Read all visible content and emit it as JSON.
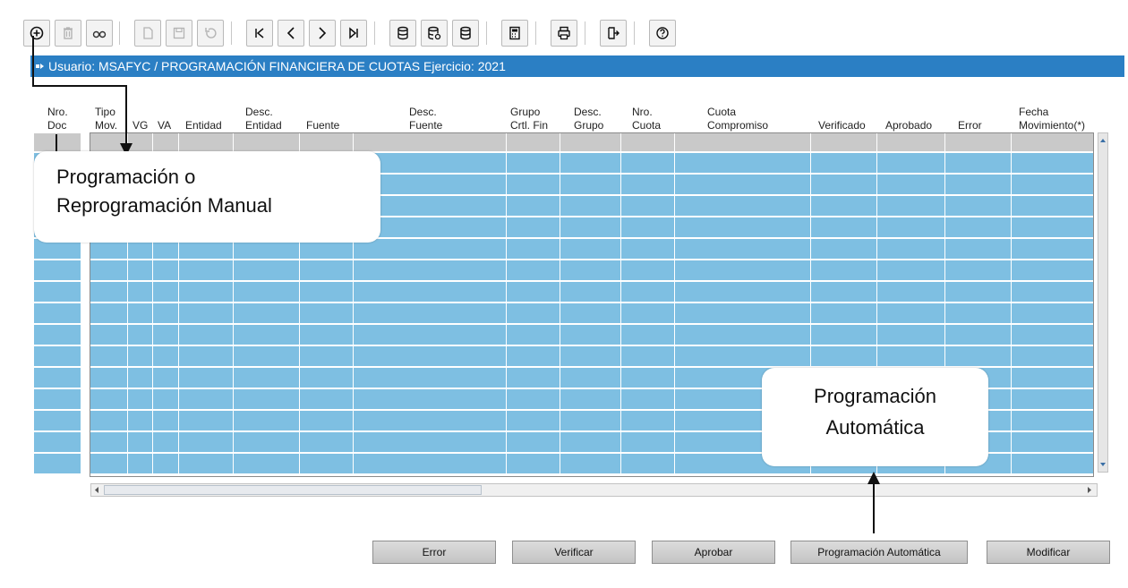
{
  "toolbar": {
    "buttons": [
      {
        "icon": "add-record-icon"
      },
      {
        "icon": "delete-record-icon"
      },
      {
        "icon": "search-binoculars-icon"
      },
      {
        "icon": "new-document-icon"
      },
      {
        "icon": "save-icon"
      },
      {
        "icon": "undo-icon"
      },
      {
        "icon": "first-record-icon"
      },
      {
        "icon": "previous-record-icon"
      },
      {
        "icon": "next-record-icon"
      },
      {
        "icon": "last-record-icon"
      },
      {
        "icon": "database-query-icon"
      },
      {
        "icon": "database-execute-icon"
      },
      {
        "icon": "database-count-icon"
      },
      {
        "icon": "calculator-icon"
      },
      {
        "icon": "print-icon"
      },
      {
        "icon": "exit-icon"
      },
      {
        "icon": "help-icon"
      }
    ]
  },
  "window": {
    "title": "Usuario: MSAFYC  /  PROGRAMACIÓN FINANCIERA DE CUOTAS  Ejercicio: 2021"
  },
  "grid": {
    "columns": [
      {
        "key": "nro_doc",
        "line1": "Nro.",
        "line2": "Doc"
      },
      {
        "key": "tipo_mov",
        "line1": "Tipo",
        "line2": "Mov."
      },
      {
        "key": "vg",
        "line1": "",
        "line2": "VG"
      },
      {
        "key": "va",
        "line1": "",
        "line2": "VA"
      },
      {
        "key": "entidad",
        "line1": "",
        "line2": "Entidad"
      },
      {
        "key": "desc_entidad",
        "line1": "Desc.",
        "line2": "Entidad"
      },
      {
        "key": "fuente",
        "line1": "",
        "line2": "Fuente"
      },
      {
        "key": "desc_fuente",
        "line1": "Desc.",
        "line2": "Fuente"
      },
      {
        "key": "grupo_crtl",
        "line1": "Grupo",
        "line2": "Crtl. Fin"
      },
      {
        "key": "desc_grupo",
        "line1": "Desc.",
        "line2": "Grupo"
      },
      {
        "key": "nro_cuota",
        "line1": "Nro.",
        "line2": "Cuota"
      },
      {
        "key": "cuota_compromiso",
        "line1": "Cuota",
        "line2": "Compromiso"
      },
      {
        "key": "verificado",
        "line1": "",
        "line2": "Verificado"
      },
      {
        "key": "aprobado",
        "line1": "",
        "line2": "Aprobado"
      },
      {
        "key": "error",
        "line1": "",
        "line2": "Error"
      },
      {
        "key": "fecha_mov",
        "line1": "Fecha",
        "line2": "Movimiento(*)"
      }
    ],
    "row_count": 15
  },
  "actions": {
    "error": "Error",
    "verificar": "Verificar",
    "aprobar": "Aprobar",
    "programacion_automatica": "Programación Automática",
    "modificar": "Modificar"
  },
  "annotations": {
    "manual_line1": "Programación o",
    "manual_line2": "Reprogramación Manual",
    "auto_line1": "Programación",
    "auto_line2": "Automática"
  },
  "colors": {
    "titlebar": "#2b7fc4",
    "cell_blue": "#7ebfe2",
    "cell_gray": "#c9c9c9"
  }
}
